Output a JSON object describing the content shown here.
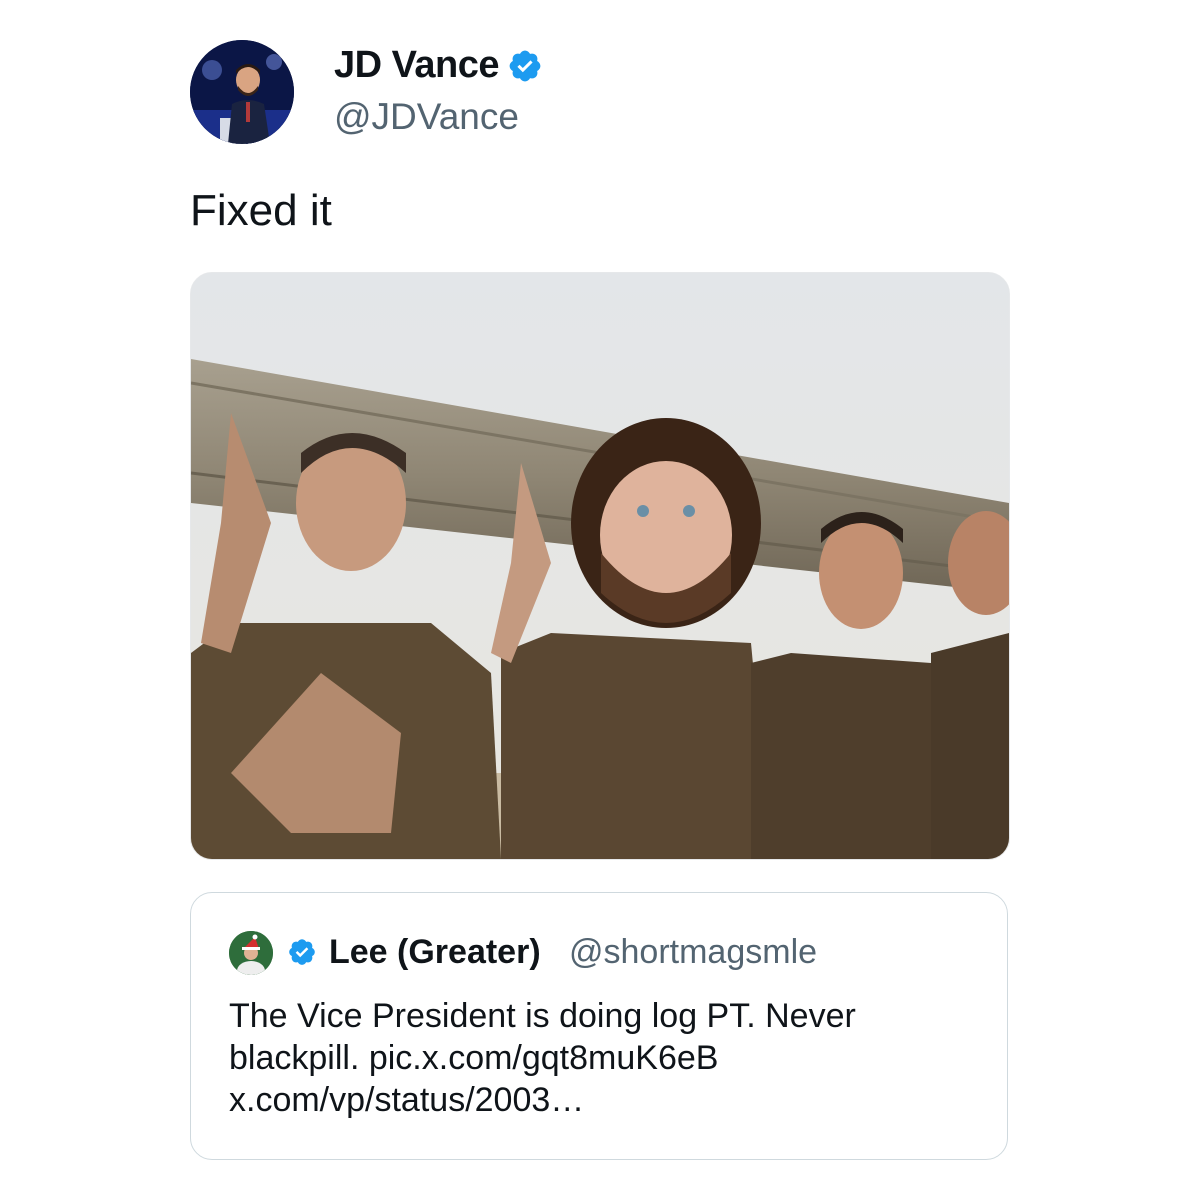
{
  "author": {
    "display_name": "JD Vance",
    "handle": "@JDVance",
    "verified": true,
    "avatar_icon": "profile-photo",
    "verified_color": "#1d9bf0"
  },
  "tweet": {
    "text": "Fixed it",
    "media_description_icon": "photo"
  },
  "quoted_tweet": {
    "display_name": "Lee (Greater)",
    "handle": "@shortmagsmle",
    "verified": true,
    "text_lines": [
      "The Vice President is doing log PT. Never",
      "blackpill. pic.x.com/gqt8muK6eB",
      "x.com/vp/status/2003…"
    ]
  },
  "colors": {
    "text_primary": "#0f1419",
    "text_secondary": "#536471",
    "border": "#cfd9de"
  }
}
